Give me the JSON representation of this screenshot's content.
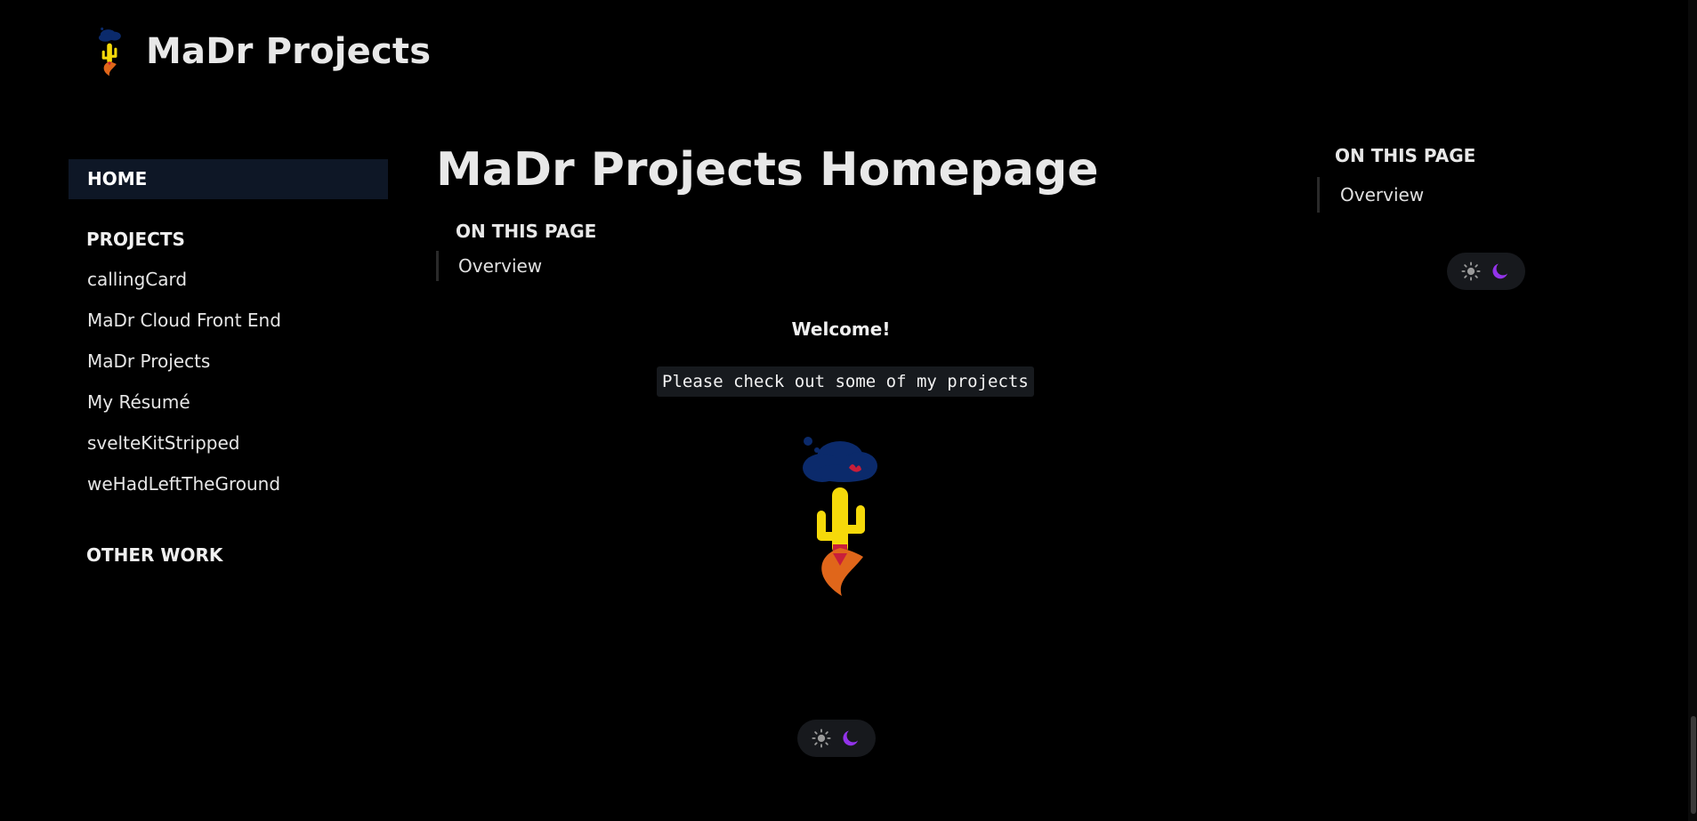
{
  "header": {
    "title": "MaDr Projects",
    "logo_icon": "cactus-rocket-icon"
  },
  "sidebar": {
    "home_label": "HOME",
    "projects_title": "PROJECTS",
    "projects": [
      "callingCard",
      "MaDr Cloud Front End",
      "MaDr Projects",
      "My Résumé",
      "svelteKitStripped",
      "weHadLeftTheGround"
    ],
    "other_title": "OTHER WORK"
  },
  "main": {
    "title": "MaDr Projects Homepage",
    "toc_heading": "ON THIS PAGE",
    "toc_link": "Overview",
    "welcome": "Welcome!",
    "code_text": "Please check out some of my projects",
    "hero_icon": "cactus-rocket-icon"
  },
  "toc_right": {
    "heading": "ON THIS PAGE",
    "link": "Overview"
  },
  "theme_toggle": {
    "light_icon": "sun-icon",
    "dark_icon": "moon-icon"
  },
  "colors": {
    "background": "#000000",
    "home_highlight": "#0e1726",
    "moon": "#9333ea",
    "cloud": "#0b2a6b",
    "cactus": "#f5d90a",
    "flame": "#e0661a"
  }
}
